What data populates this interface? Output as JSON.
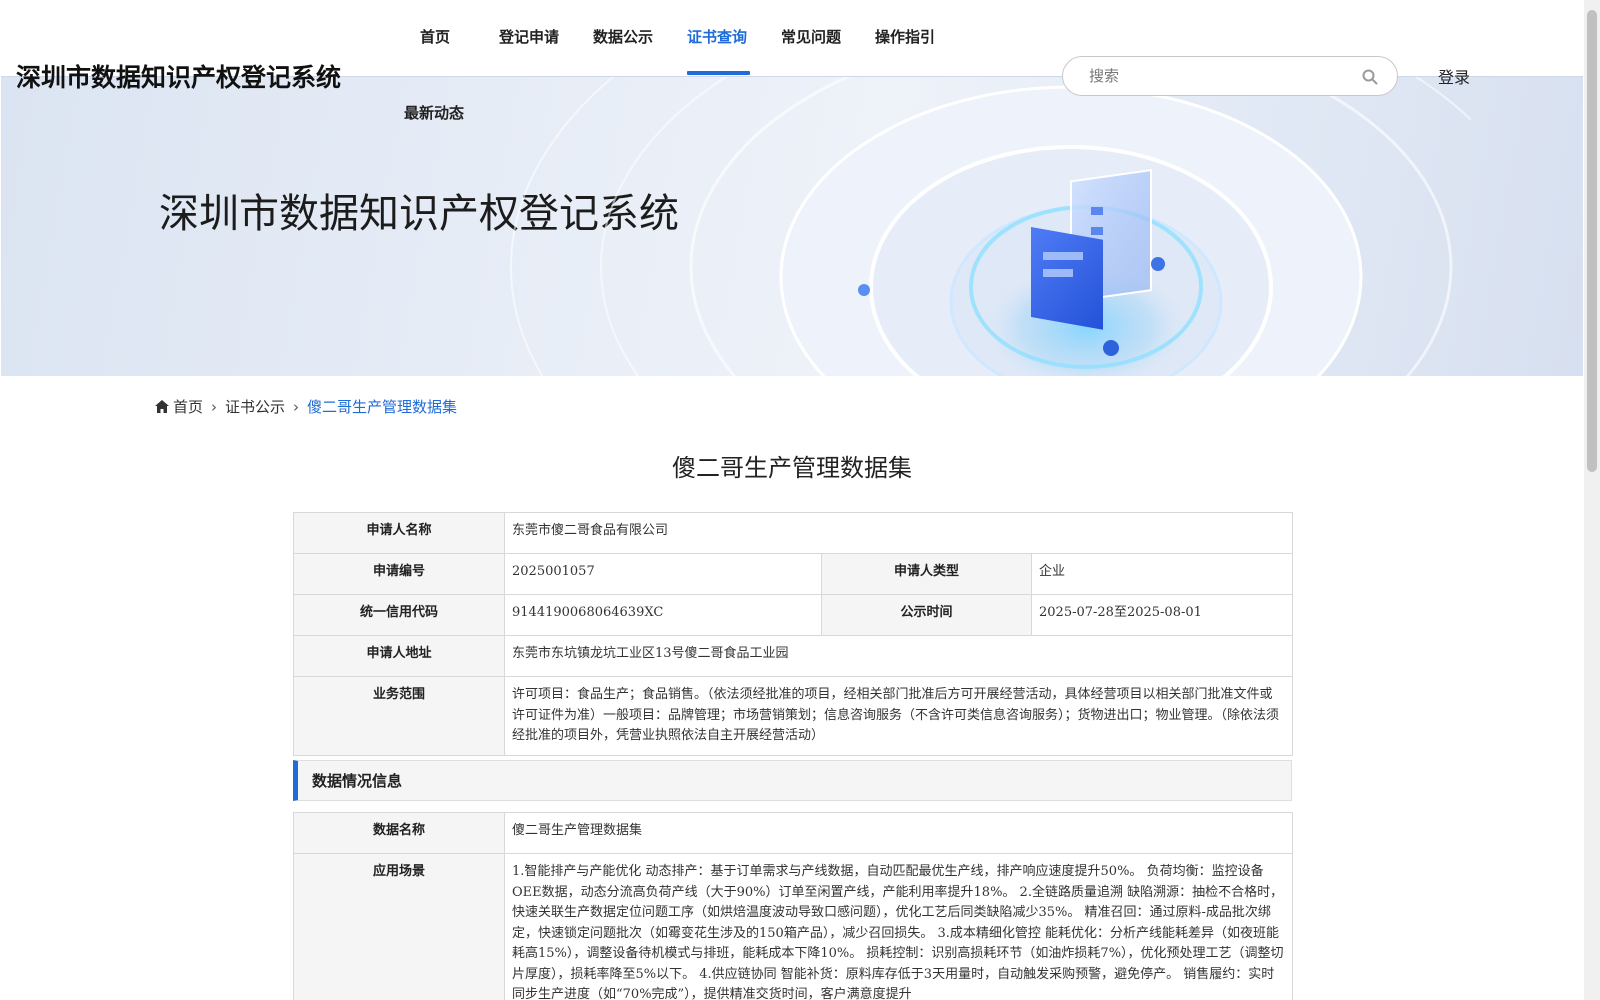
{
  "header": {
    "site_title": "深圳市数据知识产权登记系统",
    "nav": [
      {
        "label": "首页",
        "active": false
      },
      {
        "label": "登记申请",
        "active": false
      },
      {
        "label": "数据公示",
        "active": false
      },
      {
        "label": "证书查询",
        "active": true
      },
      {
        "label": "常见问题",
        "active": false
      },
      {
        "label": "操作指引",
        "active": false
      },
      {
        "label": "最新动态",
        "active": false
      }
    ],
    "search_placeholder": "搜索",
    "login_label": "登录",
    "accent_color": "#1f6bd8"
  },
  "banner": {
    "title": "深圳市数据知识产权登记系统"
  },
  "breadcrumb": {
    "items": [
      "首页",
      "证书公示",
      "傻二哥生产管理数据集"
    ]
  },
  "page_title": "傻二哥生产管理数据集",
  "applicant": {
    "name_label": "申请人名称",
    "name_value": "东莞市傻二哥食品有限公司",
    "number_label": "申请编号",
    "number_value": "2025001057",
    "type_label": "申请人类型",
    "type_value": "企业",
    "credit_label": "统一信用代码",
    "credit_value": "9144190068064639XC",
    "publicity_label": "公示时间",
    "publicity_value": "2025-07-28至2025-08-01",
    "address_label": "申请人地址",
    "address_value": "东莞市东坑镇龙坑工业区13号傻二哥食品工业园",
    "scope_label": "业务范围",
    "scope_value": "许可项目：食品生产；食品销售。（依法须经批准的项目，经相关部门批准后方可开展经营活动，具体经营项目以相关部门批准文件或许可证件为准）一般项目：品牌管理；市场营销策划；信息咨询服务（不含许可类信息咨询服务）；货物进出口；物业管理。（除依法须经批准的项目外，凭营业执照依法自主开展经营活动）"
  },
  "data_section": {
    "header": "数据情况信息",
    "name_label": "数据名称",
    "name_value": "傻二哥生产管理数据集",
    "scenario_label": "应用场景",
    "scenario_value": "1.智能排产与产能优化 动态排产：基于订单需求与产线数据，自动匹配最优生产线，排产响应速度提升50%。 负荷均衡：监控设备OEE数据，动态分流高负荷产线（大于90%）订单至闲置产线，产能利用率提升18%。 2.全链路质量追溯 缺陷溯源：抽检不合格时，快速关联生产数据定位问题工序（如烘焙温度波动导致口感问题），优化工艺后同类缺陷减少35%。 精准召回：通过原料-成品批次绑定，快速锁定问题批次（如霉变花生涉及的150箱产品），减少召回损失。 3.成本精细化管控 能耗优化：分析产线能耗差异（如夜班能耗高15%），调整设备待机模式与排班，能耗成本下降10%。 损耗控制：识别高损耗环节（如油炸损耗7%），优化预处理工艺（调整切片厚度），损耗率降至5%以下。 4.供应链协同 智能补货：原料库存低于3天用量时，自动触发采购预警，避免停产。 销售履约：实时同步生产进度（如“70%完成”），提供精准交货时间，客户满意度提升"
  }
}
